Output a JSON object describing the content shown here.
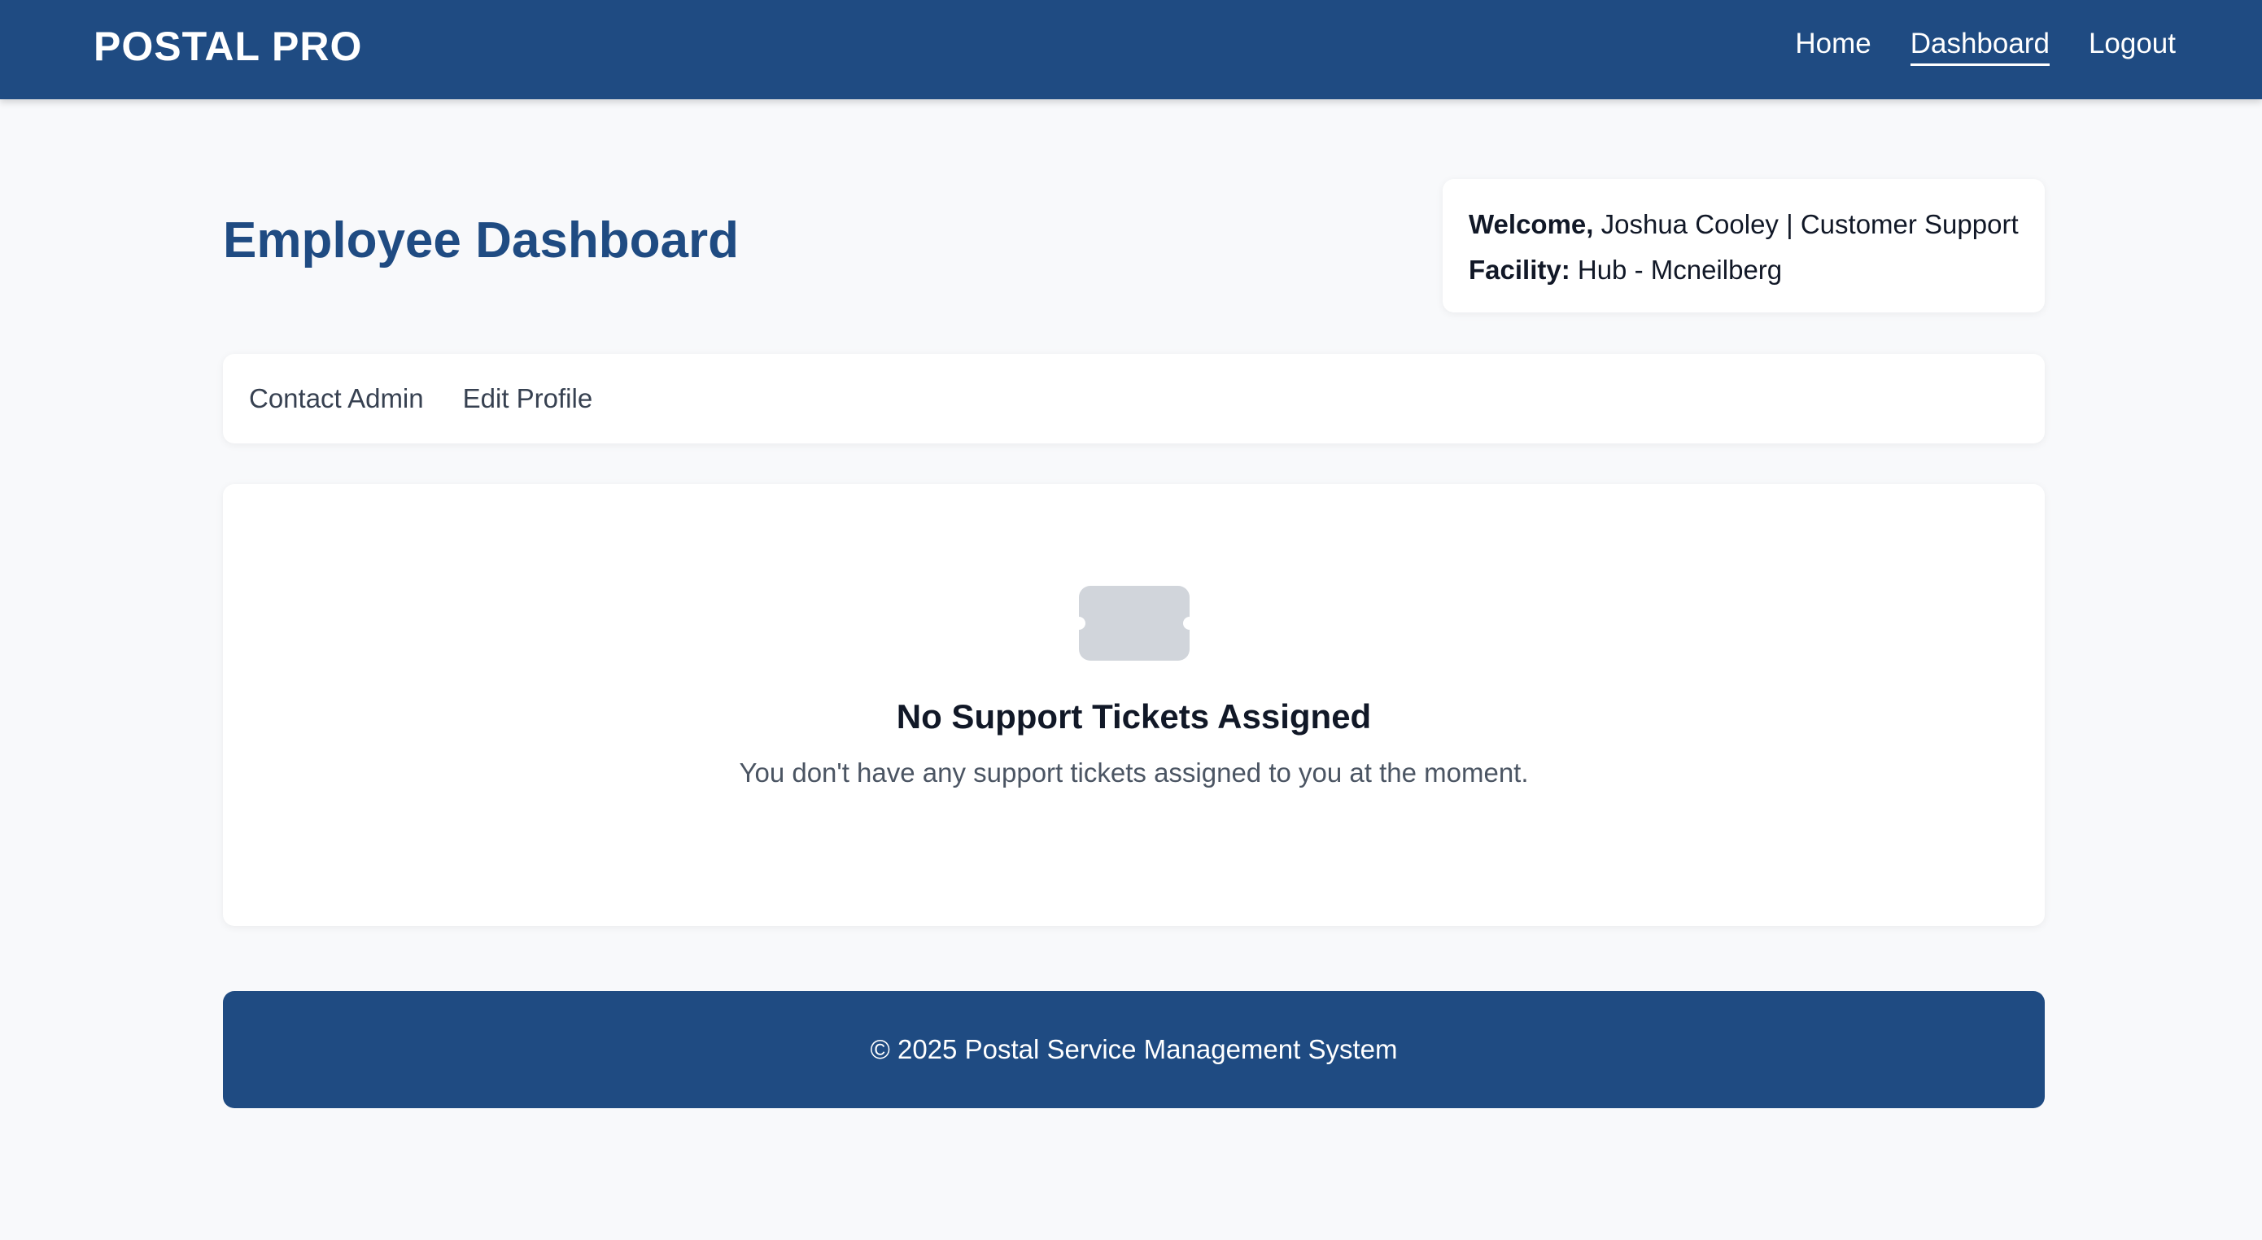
{
  "header": {
    "brand": "POSTAL PRO",
    "nav": [
      {
        "label": "Home",
        "active": false
      },
      {
        "label": "Dashboard",
        "active": true
      },
      {
        "label": "Logout",
        "active": false
      }
    ]
  },
  "page": {
    "title": "Employee Dashboard"
  },
  "welcome": {
    "welcome_label": "Welcome,",
    "user_info": "Joshua Cooley | Customer Support",
    "facility_label": "Facility:",
    "facility_value": "Hub - Mcneilberg"
  },
  "actions": [
    {
      "label": "Contact Admin"
    },
    {
      "label": "Edit Profile"
    }
  ],
  "empty_state": {
    "icon": "ticket-icon",
    "title": "No Support Tickets Assigned",
    "message": "You don't have any support tickets assigned to you at the moment."
  },
  "footer": {
    "text": "© 2025 Postal Service Management System"
  },
  "colors": {
    "primary": "#1f4b82",
    "background": "#f8f9fb",
    "icon_gray": "#d1d5db"
  }
}
